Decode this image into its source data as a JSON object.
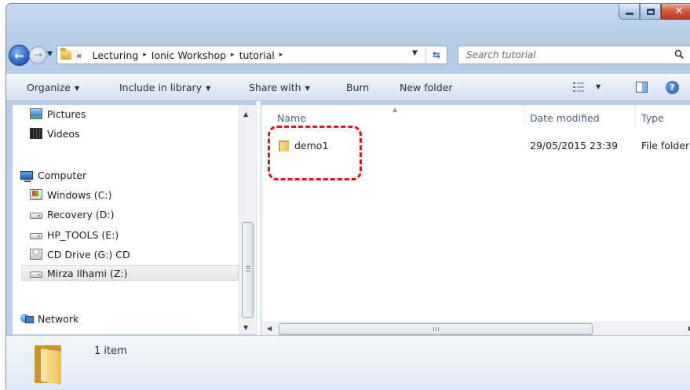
{
  "window": {
    "close_glyph": "✕"
  },
  "address_bar": {
    "overflow_marker": "«",
    "crumbs": [
      "Lecturing",
      "Ionic Workshop",
      "tutorial"
    ],
    "separator": "▸"
  },
  "search": {
    "placeholder": "Search tutorial"
  },
  "toolbar": {
    "organize": "Organize",
    "include_in_library": "Include in library",
    "share_with": "Share with",
    "burn": "Burn",
    "new_folder": "New folder",
    "help_glyph": "?"
  },
  "nav_pane": {
    "items": [
      {
        "label": "Pictures",
        "icon": "pictures-icon"
      },
      {
        "label": "Videos",
        "icon": "videos-icon"
      },
      {
        "label": "Computer",
        "icon": "computer-icon"
      },
      {
        "label": "Windows (C:)",
        "icon": "windows-drive-icon"
      },
      {
        "label": "Recovery (D:)",
        "icon": "drive-icon"
      },
      {
        "label": "HP_TOOLS (E:)",
        "icon": "drive-icon"
      },
      {
        "label": "CD Drive (G:) CD",
        "icon": "cd-drive-icon"
      },
      {
        "label": "Mirza Ilhami (Z:)",
        "icon": "network-drive-icon",
        "selected": true
      },
      {
        "label": "Network",
        "icon": "network-icon"
      }
    ]
  },
  "file_list": {
    "columns": [
      "Name",
      "Date modified",
      "Type"
    ],
    "rows": [
      {
        "name": "demo1",
        "date_modified": "29/05/2015 23:39",
        "type": "File folder",
        "icon": "folder-icon"
      }
    ]
  },
  "details_pane": {
    "item_count": "1 item"
  },
  "colors": {
    "highlight": "#cc1e1e",
    "title_bar": "#c9daf0",
    "close_button": "#c23a20"
  }
}
